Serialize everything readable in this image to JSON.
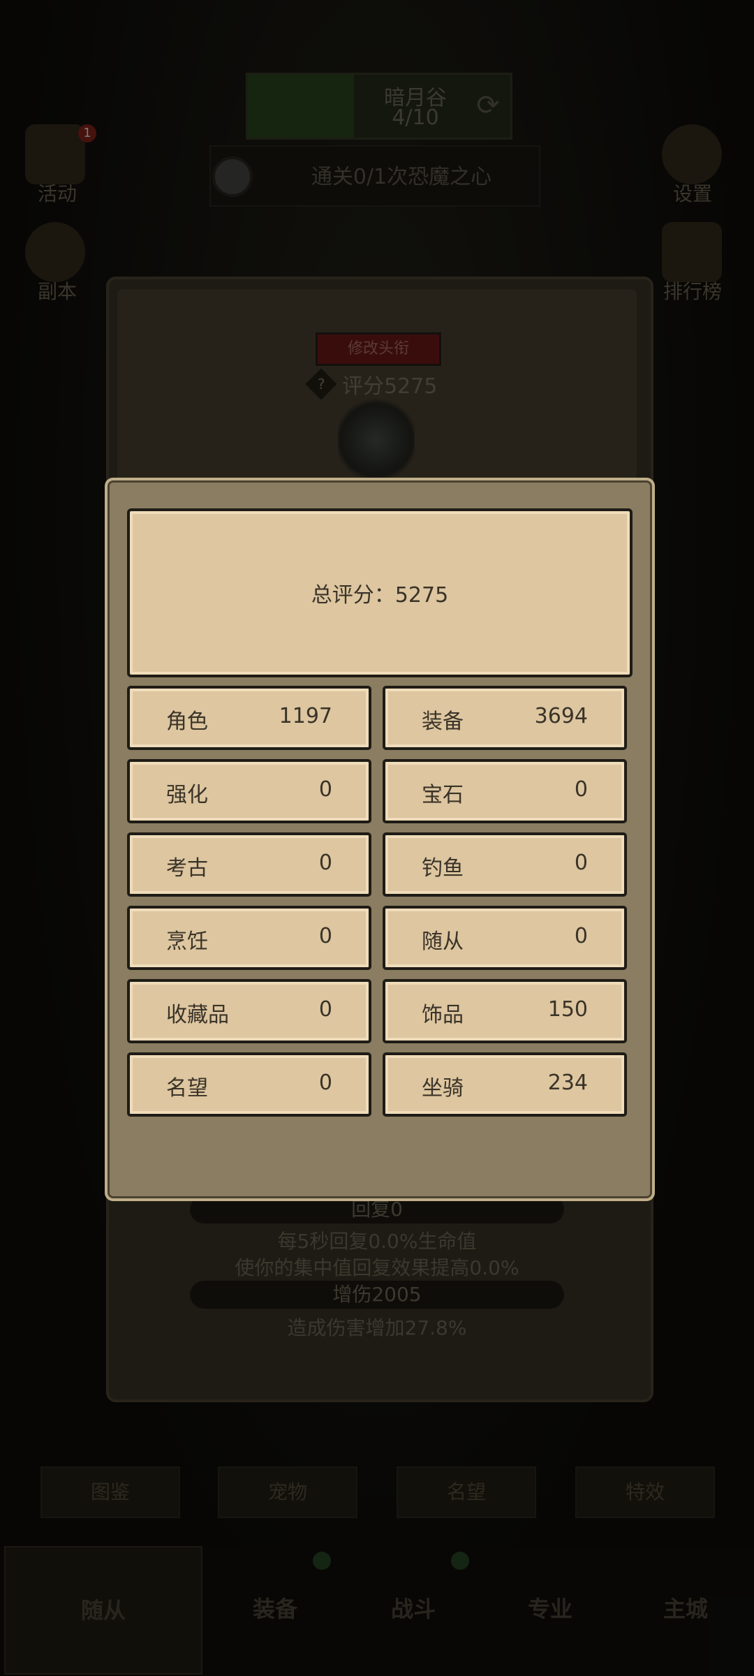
{
  "hud": {
    "map_name": "暗月谷",
    "map_progress": "4/10",
    "quest": "通关0/1次恐魔之心",
    "left_icons": [
      {
        "label": "活动",
        "badge": "1"
      },
      {
        "label": "副本"
      }
    ],
    "right_icons": [
      {
        "label": "设置"
      },
      {
        "label": "排行榜"
      }
    ]
  },
  "profile": {
    "edit_title_button": "修改头衔",
    "help_icon": "?",
    "score_label": "评分5275"
  },
  "score_dialog": {
    "total_label": "总评分：5275",
    "items": [
      {
        "label": "角色",
        "value": "1197"
      },
      {
        "label": "装备",
        "value": "3694"
      },
      {
        "label": "强化",
        "value": "0"
      },
      {
        "label": "宝石",
        "value": "0"
      },
      {
        "label": "考古",
        "value": "0"
      },
      {
        "label": "钓鱼",
        "value": "0"
      },
      {
        "label": "烹饪",
        "value": "0"
      },
      {
        "label": "随从",
        "value": "0"
      },
      {
        "label": "收藏品",
        "value": "0"
      },
      {
        "label": "饰品",
        "value": "150"
      },
      {
        "label": "名望",
        "value": "0"
      },
      {
        "label": "坐骑",
        "value": "234"
      }
    ]
  },
  "stats": {
    "regen_title": "回复0",
    "regen_line1": "每5秒回复0.0%生命值",
    "regen_line2": "使你的集中值回复效果提高0.0%",
    "damage_title": "增伤2005",
    "damage_line": "造成伤害增加27.8%"
  },
  "bottom_buttons": [
    "图鉴",
    "宠物",
    "名望",
    "特效"
  ],
  "tabs": [
    "随从",
    "装备",
    "战斗",
    "专业",
    "主城"
  ],
  "colors": {
    "panel": "#8a7d61",
    "cell": "#ddc6a0",
    "text": "#3a3328",
    "title_button": "#5a1414"
  }
}
